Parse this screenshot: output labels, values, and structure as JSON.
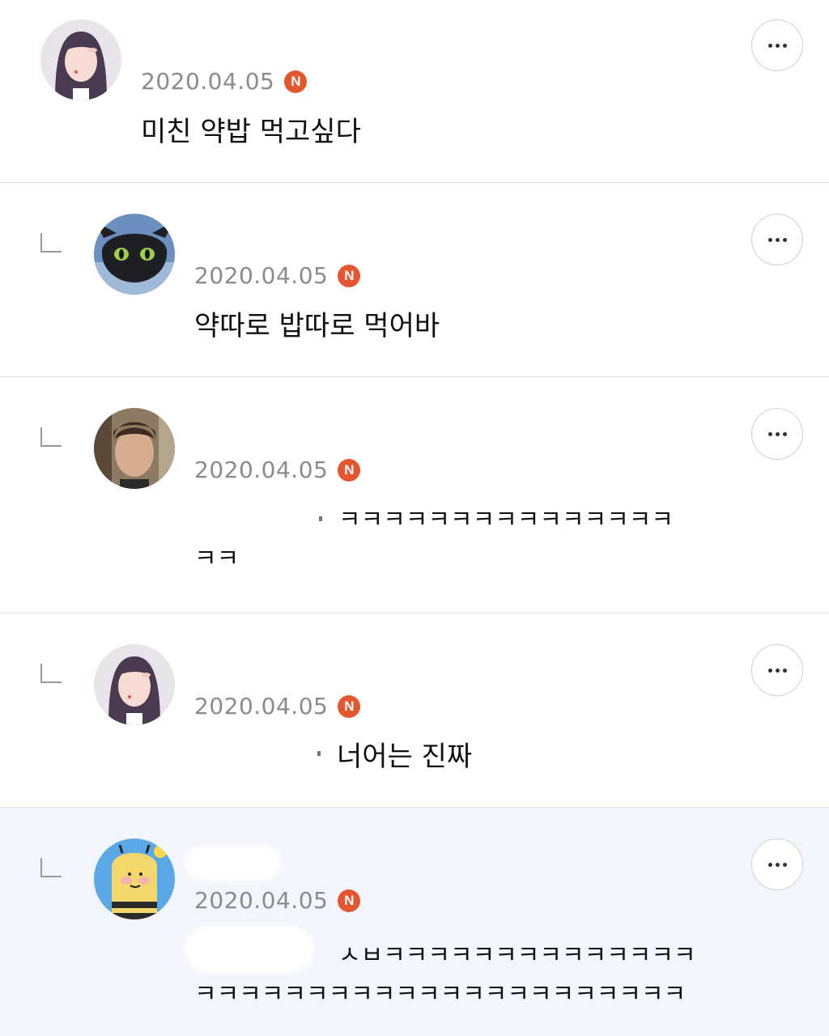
{
  "badge_label": "N",
  "comments": [
    {
      "date": "2020.04.05",
      "text": "미친 약밥 먹고싶다",
      "avatar": "girl-avatar"
    },
    {
      "date": "2020.04.05",
      "text": "약따로 밥따로 먹어바",
      "avatar": "toothless-avatar"
    },
    {
      "date": "2020.04.05",
      "text_line1": "ㅋㅋㅋㅋㅋㅋㅋㅋㅋㅋㅋㅋㅋㅋㅋ",
      "text_line2": "ㅋㅋ",
      "avatar": "boy-avatar"
    },
    {
      "date": "2020.04.05",
      "text": "너어는 진짜",
      "avatar": "girl-avatar"
    },
    {
      "date": "2020.04.05",
      "text_line1": "ㅅㅂㅋㅋㅋㅋㅋㅋㅋㅋㅋㅋㅋㅋㅋㅋ",
      "text_line2": "ㅋㅋㅋㅋㅋㅋㅋㅋㅋㅋㅋㅋㅋㅋㅋㅋㅋㅋㅋㅋㅋㅋ",
      "avatar": "cartoon-avatar"
    }
  ],
  "colors": {
    "badge": "#e4572e",
    "date": "#8b8b8b",
    "highlight_bg": "#f2f5fb"
  }
}
